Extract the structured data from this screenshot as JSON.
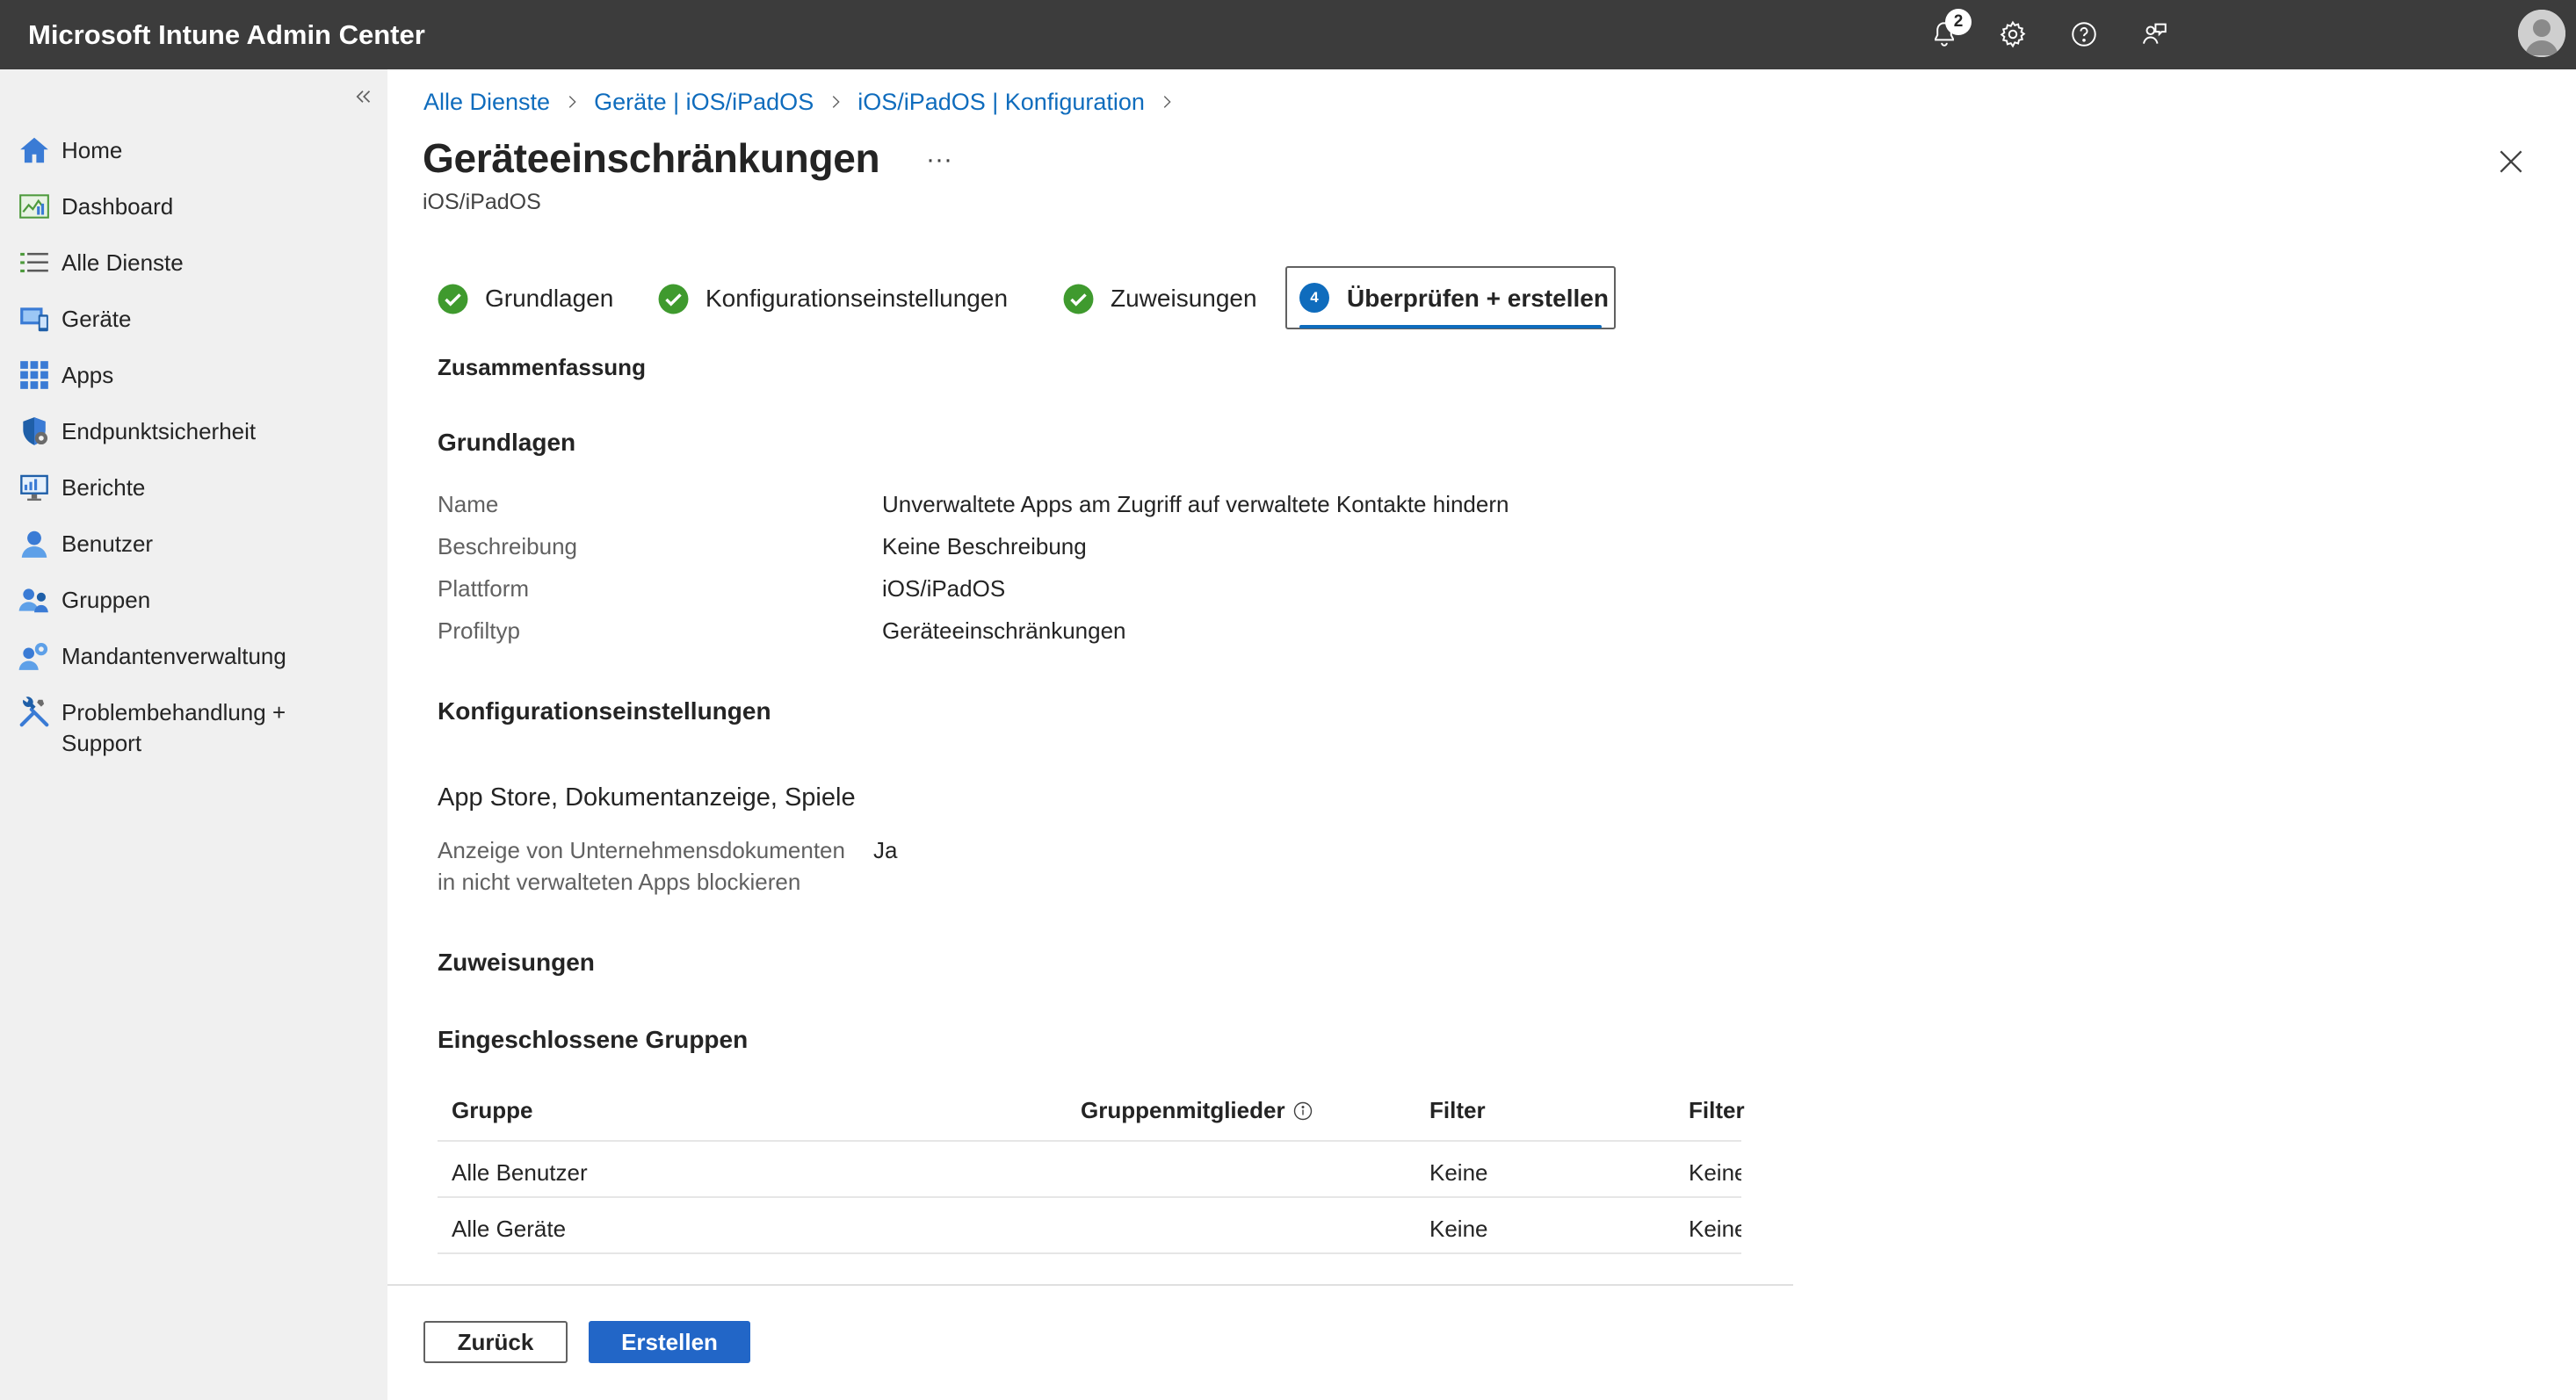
{
  "app": {
    "title": "Microsoft Intune Admin Center"
  },
  "topbar": {
    "notifications": {
      "icon": "bell-icon",
      "count": "2"
    },
    "icons": [
      "bell-icon",
      "gear-icon",
      "help-icon",
      "feedback-icon",
      "avatar"
    ]
  },
  "sidebar": {
    "items": [
      {
        "label": "Home",
        "icon": "home-icon"
      },
      {
        "label": "Dashboard",
        "icon": "dashboard-icon"
      },
      {
        "label": "Alle Dienste",
        "icon": "list-icon"
      },
      {
        "label": "Geräte",
        "icon": "devices-icon"
      },
      {
        "label": "Apps",
        "icon": "apps-grid-icon"
      },
      {
        "label": "Endpunktsicherheit",
        "icon": "shield-icon"
      },
      {
        "label": "Berichte",
        "icon": "reports-icon"
      },
      {
        "label": "Benutzer",
        "icon": "user-icon"
      },
      {
        "label": "Gruppen",
        "icon": "groups-icon"
      },
      {
        "label": "Mandantenverwaltung",
        "icon": "tenant-admin-icon"
      },
      {
        "label": "Problembehandlung + Support",
        "icon": "troubleshoot-icon"
      }
    ]
  },
  "breadcrumb": [
    "Alle Dienste",
    "Geräte | iOS/iPadOS",
    "iOS/iPadOS | Konfiguration"
  ],
  "page": {
    "title": "Geräteeinschränkungen",
    "more": "···",
    "subtitle": "iOS/iPadOS"
  },
  "tabs": [
    {
      "label": "Grundlagen",
      "state": "done"
    },
    {
      "label": "Konfigurationseinstellungen",
      "state": "done"
    },
    {
      "label": "Zuweisungen",
      "state": "done"
    },
    {
      "label": "Überprüfen + erstellen",
      "state": "active",
      "number": "4"
    }
  ],
  "summary": {
    "heading": "Zusammenfassung",
    "basics": {
      "heading": "Grundlagen",
      "rows": [
        {
          "label": "Name",
          "value": "Unverwaltete Apps am Zugriff auf verwaltete Kontakte hindern"
        },
        {
          "label": "Beschreibung",
          "value": "Keine Beschreibung"
        },
        {
          "label": "Plattform",
          "value": "iOS/iPadOS"
        },
        {
          "label": "Profiltyp",
          "value": "Geräteeinschränkungen"
        }
      ]
    },
    "config": {
      "heading": "Konfigurationseinstellungen",
      "category": "App Store, Dokumentanzeige, Spiele",
      "setting": {
        "label": "Anzeige von Unternehmensdokumenten in nicht verwalteten Apps blockieren",
        "value": "Ja"
      }
    },
    "assignments": {
      "heading": "Zuweisungen",
      "included_heading": "Eingeschlossene Gruppen",
      "columns": [
        "Gruppe",
        "Gruppenmitglieder",
        "Filter",
        "Filter"
      ],
      "rows": [
        {
          "group": "Alle Benutzer",
          "members": "",
          "filter": "Keine",
          "filter2": "Keine"
        },
        {
          "group": "Alle Geräte",
          "members": "",
          "filter": "Keine",
          "filter2": "Keine"
        }
      ]
    }
  },
  "footer": {
    "back_label": "Zurück",
    "create_label": "Erstellen"
  },
  "colors": {
    "topbar": "#3c3c3c",
    "sidebar": "#f0f0f0",
    "accent": "#0f6cbd",
    "primary_button": "#2266c7",
    "check": "#3f9a2e"
  }
}
